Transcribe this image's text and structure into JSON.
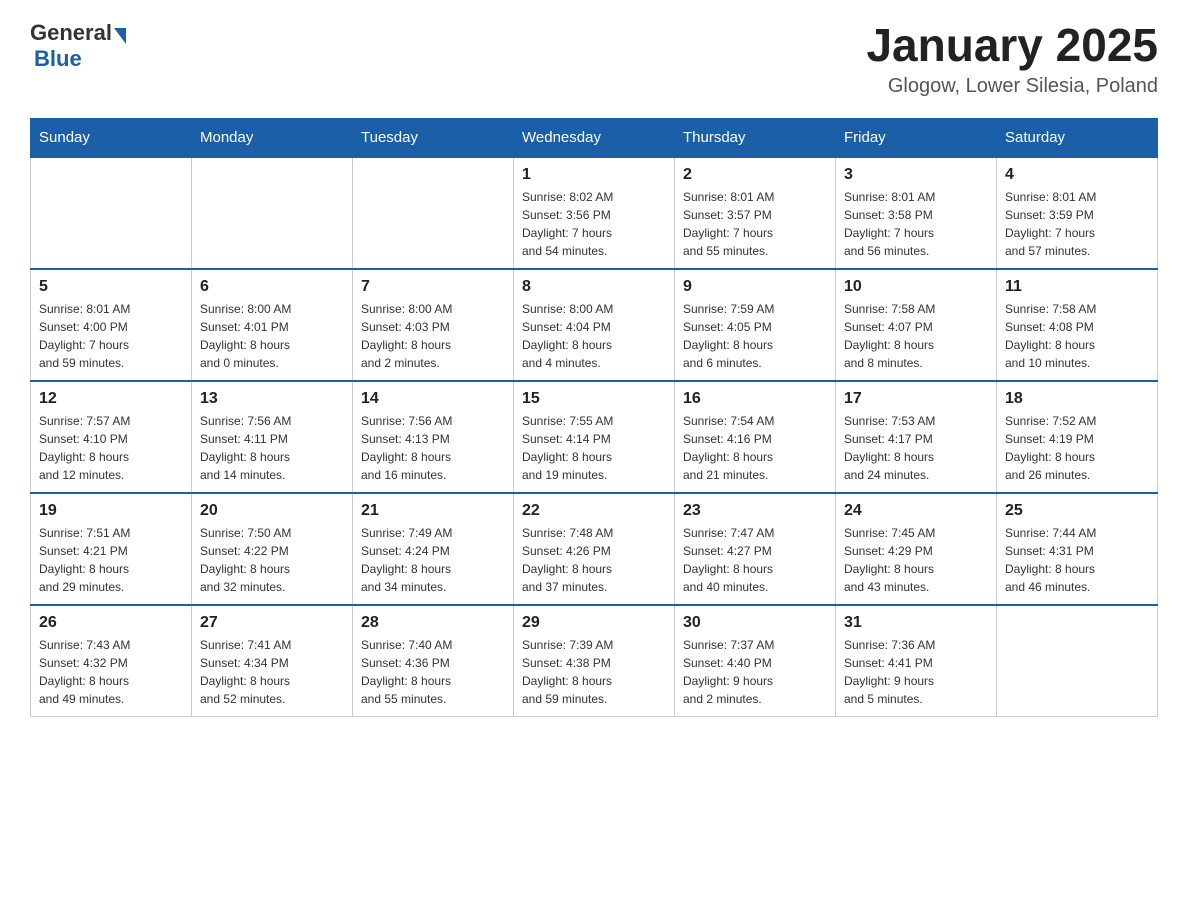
{
  "logo": {
    "general": "General",
    "blue": "Blue",
    "triangle": "▶"
  },
  "title": "January 2025",
  "subtitle": "Glogow, Lower Silesia, Poland",
  "days_of_week": [
    "Sunday",
    "Monday",
    "Tuesday",
    "Wednesday",
    "Thursday",
    "Friday",
    "Saturday"
  ],
  "weeks": [
    [
      {
        "day": "",
        "info": ""
      },
      {
        "day": "",
        "info": ""
      },
      {
        "day": "",
        "info": ""
      },
      {
        "day": "1",
        "info": "Sunrise: 8:02 AM\nSunset: 3:56 PM\nDaylight: 7 hours\nand 54 minutes."
      },
      {
        "day": "2",
        "info": "Sunrise: 8:01 AM\nSunset: 3:57 PM\nDaylight: 7 hours\nand 55 minutes."
      },
      {
        "day": "3",
        "info": "Sunrise: 8:01 AM\nSunset: 3:58 PM\nDaylight: 7 hours\nand 56 minutes."
      },
      {
        "day": "4",
        "info": "Sunrise: 8:01 AM\nSunset: 3:59 PM\nDaylight: 7 hours\nand 57 minutes."
      }
    ],
    [
      {
        "day": "5",
        "info": "Sunrise: 8:01 AM\nSunset: 4:00 PM\nDaylight: 7 hours\nand 59 minutes."
      },
      {
        "day": "6",
        "info": "Sunrise: 8:00 AM\nSunset: 4:01 PM\nDaylight: 8 hours\nand 0 minutes."
      },
      {
        "day": "7",
        "info": "Sunrise: 8:00 AM\nSunset: 4:03 PM\nDaylight: 8 hours\nand 2 minutes."
      },
      {
        "day": "8",
        "info": "Sunrise: 8:00 AM\nSunset: 4:04 PM\nDaylight: 8 hours\nand 4 minutes."
      },
      {
        "day": "9",
        "info": "Sunrise: 7:59 AM\nSunset: 4:05 PM\nDaylight: 8 hours\nand 6 minutes."
      },
      {
        "day": "10",
        "info": "Sunrise: 7:58 AM\nSunset: 4:07 PM\nDaylight: 8 hours\nand 8 minutes."
      },
      {
        "day": "11",
        "info": "Sunrise: 7:58 AM\nSunset: 4:08 PM\nDaylight: 8 hours\nand 10 minutes."
      }
    ],
    [
      {
        "day": "12",
        "info": "Sunrise: 7:57 AM\nSunset: 4:10 PM\nDaylight: 8 hours\nand 12 minutes."
      },
      {
        "day": "13",
        "info": "Sunrise: 7:56 AM\nSunset: 4:11 PM\nDaylight: 8 hours\nand 14 minutes."
      },
      {
        "day": "14",
        "info": "Sunrise: 7:56 AM\nSunset: 4:13 PM\nDaylight: 8 hours\nand 16 minutes."
      },
      {
        "day": "15",
        "info": "Sunrise: 7:55 AM\nSunset: 4:14 PM\nDaylight: 8 hours\nand 19 minutes."
      },
      {
        "day": "16",
        "info": "Sunrise: 7:54 AM\nSunset: 4:16 PM\nDaylight: 8 hours\nand 21 minutes."
      },
      {
        "day": "17",
        "info": "Sunrise: 7:53 AM\nSunset: 4:17 PM\nDaylight: 8 hours\nand 24 minutes."
      },
      {
        "day": "18",
        "info": "Sunrise: 7:52 AM\nSunset: 4:19 PM\nDaylight: 8 hours\nand 26 minutes."
      }
    ],
    [
      {
        "day": "19",
        "info": "Sunrise: 7:51 AM\nSunset: 4:21 PM\nDaylight: 8 hours\nand 29 minutes."
      },
      {
        "day": "20",
        "info": "Sunrise: 7:50 AM\nSunset: 4:22 PM\nDaylight: 8 hours\nand 32 minutes."
      },
      {
        "day": "21",
        "info": "Sunrise: 7:49 AM\nSunset: 4:24 PM\nDaylight: 8 hours\nand 34 minutes."
      },
      {
        "day": "22",
        "info": "Sunrise: 7:48 AM\nSunset: 4:26 PM\nDaylight: 8 hours\nand 37 minutes."
      },
      {
        "day": "23",
        "info": "Sunrise: 7:47 AM\nSunset: 4:27 PM\nDaylight: 8 hours\nand 40 minutes."
      },
      {
        "day": "24",
        "info": "Sunrise: 7:45 AM\nSunset: 4:29 PM\nDaylight: 8 hours\nand 43 minutes."
      },
      {
        "day": "25",
        "info": "Sunrise: 7:44 AM\nSunset: 4:31 PM\nDaylight: 8 hours\nand 46 minutes."
      }
    ],
    [
      {
        "day": "26",
        "info": "Sunrise: 7:43 AM\nSunset: 4:32 PM\nDaylight: 8 hours\nand 49 minutes."
      },
      {
        "day": "27",
        "info": "Sunrise: 7:41 AM\nSunset: 4:34 PM\nDaylight: 8 hours\nand 52 minutes."
      },
      {
        "day": "28",
        "info": "Sunrise: 7:40 AM\nSunset: 4:36 PM\nDaylight: 8 hours\nand 55 minutes."
      },
      {
        "day": "29",
        "info": "Sunrise: 7:39 AM\nSunset: 4:38 PM\nDaylight: 8 hours\nand 59 minutes."
      },
      {
        "day": "30",
        "info": "Sunrise: 7:37 AM\nSunset: 4:40 PM\nDaylight: 9 hours\nand 2 minutes."
      },
      {
        "day": "31",
        "info": "Sunrise: 7:36 AM\nSunset: 4:41 PM\nDaylight: 9 hours\nand 5 minutes."
      },
      {
        "day": "",
        "info": ""
      }
    ]
  ]
}
